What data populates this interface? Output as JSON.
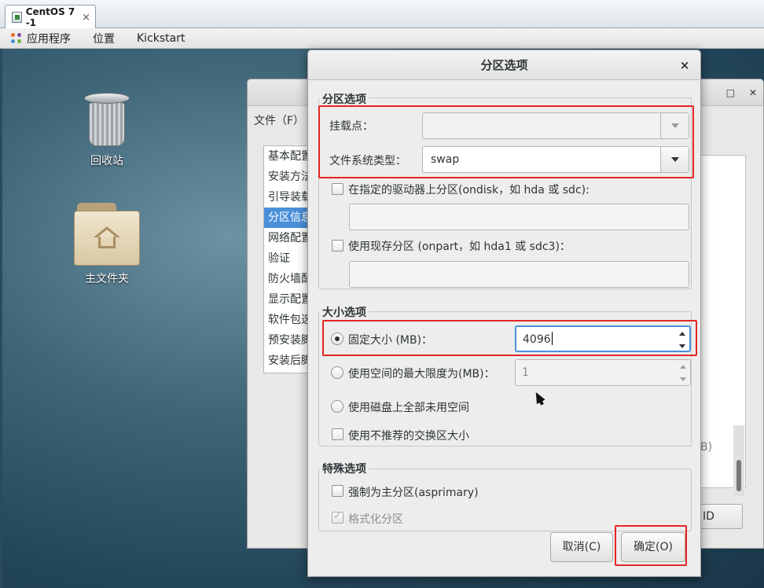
{
  "vm": {
    "tab_title": "CentOS 7 -1",
    "tab_close": "×"
  },
  "topbar": {
    "apps": "应用程序",
    "places": "位置",
    "app_name": "Kickstart"
  },
  "desktop": {
    "trash": "回收站",
    "home": "主文件夹"
  },
  "bg_window": {
    "menu": "文件（F）",
    "nav_items": [
      "基本配置",
      "安装方法",
      "引导装载",
      "分区信息",
      "网络配置",
      "验证",
      "防火墙配置",
      "显示配置",
      "软件包选",
      "预安装脚",
      "安装后脚"
    ],
    "partial_text_1": "B)",
    "partial_button": "ID"
  },
  "dialog": {
    "title": "分区选项",
    "close": "×",
    "partition_section": "分区选项",
    "mount_point_label": "挂载点：",
    "mount_point_value": "",
    "fs_type_label": "文件系统类型：",
    "fs_type_value": "swap",
    "ondisk_label": "在指定的驱动器上分区(ondisk，如 hda 或 sdc):",
    "onpart_label": "使用现存分区 (onpart，如 hda1 或 sdc3)：",
    "size_section": "大小选项",
    "fixed_size_label": "固定大小 (MB)：",
    "fixed_size_value": "4096",
    "max_size_label": "使用空间的最大限度为(MB)：",
    "max_size_value": "1",
    "fill_disk_label": "使用磁盘上全部未用空间",
    "recommended_swap_label": "使用不推荐的交换区大小",
    "special_section": "特殊选项",
    "asprimary_label": "强制为主分区(asprimary)",
    "format_label": "格式化分区",
    "cancel_button": "取消(C)",
    "ok_button": "确定(O)"
  },
  "colors": {
    "highlight": "#e52525",
    "focus": "#4a90d9",
    "selection": "#4a90d9"
  }
}
